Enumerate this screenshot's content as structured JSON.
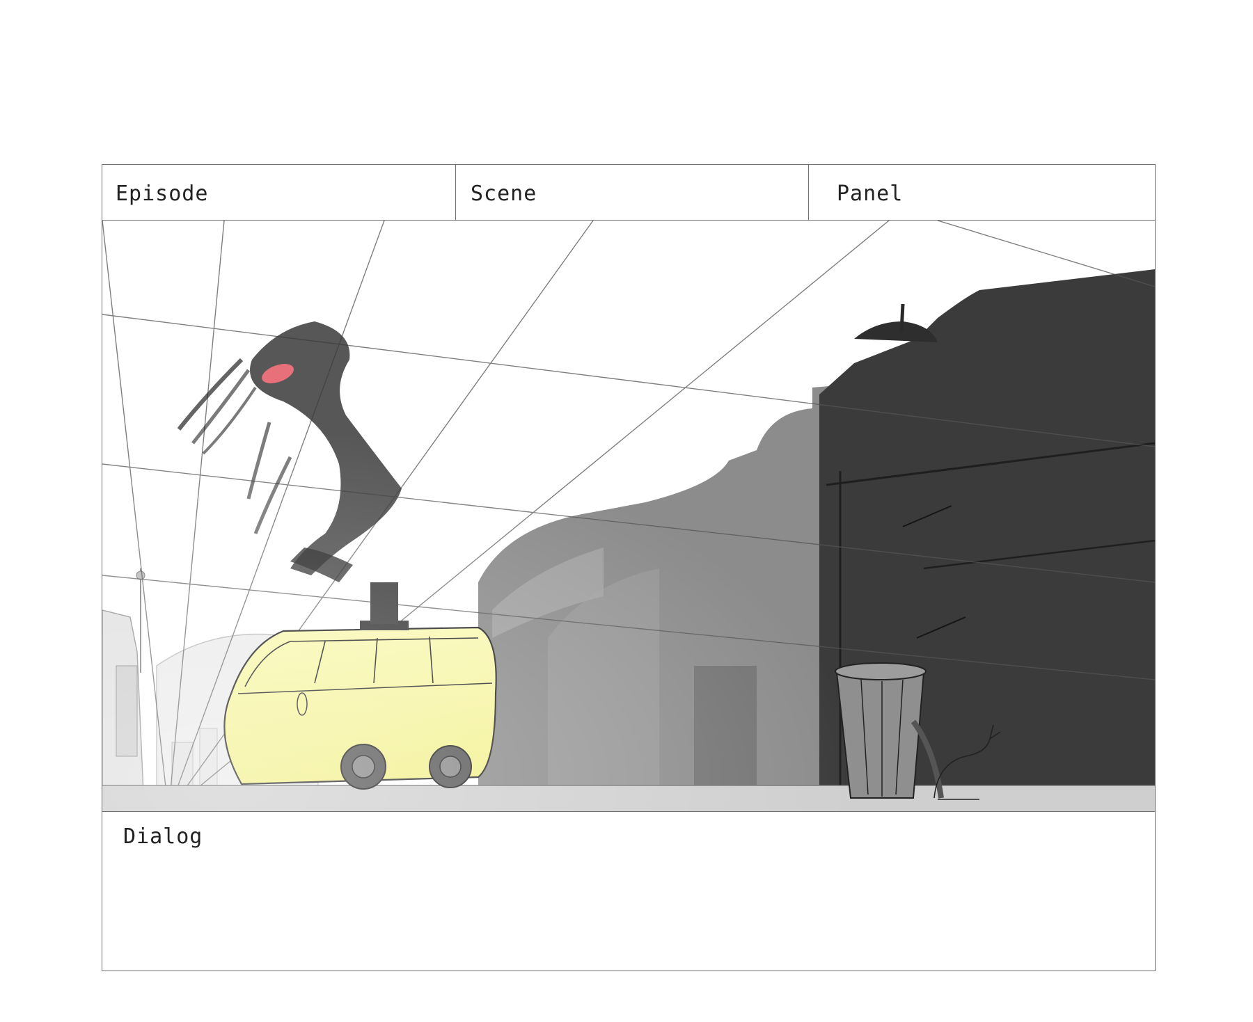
{
  "storyboard": {
    "header": {
      "episode_label": "Episode",
      "scene_label": "Scene",
      "panel_label": "Panel"
    },
    "dialog": {
      "label": "Dialog"
    },
    "drawing": {
      "character_color": "#3a3a3a",
      "accent_color": "#e8707a",
      "van_color": "#f7f59a",
      "near_wall_color": "#3b3b3b",
      "mid_wall_color": "#8c8c8c",
      "ground_color": "#cfcfcf"
    }
  }
}
